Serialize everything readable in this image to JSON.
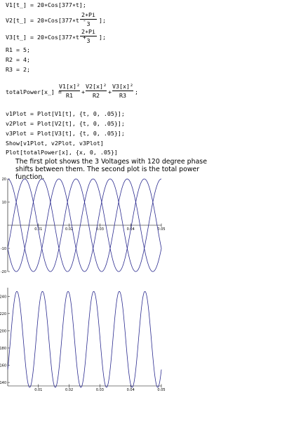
{
  "code": {
    "v1": "V1[t_] = 20∗Cos[377∗t];",
    "v2_prefix": "V2[t_] = 20∗Cos[377∗t -",
    "v2_num": "2∗Pi",
    "v2_den": "3",
    "v2_suffix": "];",
    "v3_prefix": "V3[t_] = 20∗Cos[377∗t +",
    "v3_num": "2∗Pi",
    "v3_den": "3",
    "v3_suffix": "];",
    "r1": "R1 = 5;",
    "r2": "R2 = 4;",
    "r3": "R3 = 2;",
    "tp_prefix": "totalPower[x_] =",
    "tp_n1": "V1[x]²",
    "tp_d1": "R1",
    "tp_plus1": "+",
    "tp_n2": "V2[x]²",
    "tp_d2": "R2",
    "tp_plus2": "+",
    "tp_n3": "V3[x]²",
    "tp_d3": "R3",
    "tp_suffix": ";",
    "plot1": "v1Plot = Plot[V1[t], {t, 0, .05}];",
    "plot2": "v2Plot = Plot[V2[t], {t, 0, .05}];",
    "plot3": "v3Plot = Plot[V3[t], {t, 0, .05}];",
    "show": "Show[v1Plot, v2Plot, v3Plot]",
    "plotpower": "Plot[totalPower[x], {x, 0, .05}]"
  },
  "note": "The first plot shows the 3 Voltages with 120 degree phase shifts between them. The second plot is the total power function.",
  "chart_data": [
    {
      "type": "line",
      "x_range": [
        0,
        0.05
      ],
      "ylim": [
        -20,
        20
      ],
      "xticks": [
        "0.01",
        "0.02",
        "0.03",
        "0.04",
        "0.05"
      ],
      "yticks": [
        "20",
        "10",
        "-10",
        "-20"
      ],
      "functions": [
        "20∗Cos[377∗t]",
        "20∗Cos[377∗t - 2∗Pi/3]",
        "20∗Cos[377∗t + 2∗Pi/3]"
      ],
      "series": [
        {
          "amplitude": 20,
          "omega": 377,
          "phase": 0
        },
        {
          "amplitude": 20,
          "omega": 377,
          "phase": -2.0944
        },
        {
          "amplitude": 20,
          "omega": 377,
          "phase": 2.0944
        }
      ],
      "line_color": "#2b2b8f"
    },
    {
      "type": "line",
      "x_range": [
        0,
        0.05
      ],
      "ylim": [
        136,
        250
      ],
      "xticks": [
        "0.01",
        "0.02",
        "0.03",
        "0.04",
        "0.05"
      ],
      "yticks": [
        "240",
        "220",
        "200",
        "180",
        "160",
        "140"
      ],
      "function": "totalPower[x]",
      "resistances": [
        5,
        4,
        2
      ],
      "line_color": "#2b2b8f"
    }
  ]
}
